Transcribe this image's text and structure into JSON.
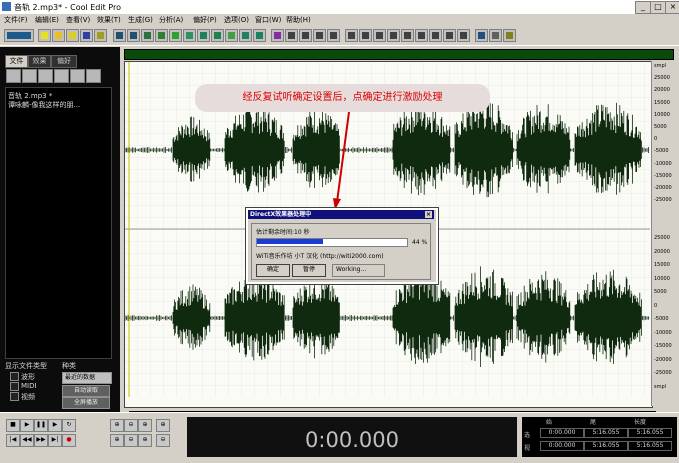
{
  "window": {
    "title": "音轨  2.mp3* - Cool Edit Pro",
    "min_label": "_",
    "max_label": "□",
    "close_label": "×"
  },
  "menu": [
    "文件(F)",
    "编辑(E)",
    "查看(V)",
    "效果(T)",
    "生成(G)",
    "分析(A)",
    "偏好(P)",
    "选项(O)",
    "窗口(W)",
    "帮助(H)"
  ],
  "left_panel": {
    "tabs": [
      "文件",
      "效果",
      "偏好"
    ],
    "files": [
      "音轨   2.mp3 *",
      "谭咏麟-像我这样的朋..."
    ],
    "show_file_type_label": "显示文件类型",
    "sort_label": "种类",
    "types": [
      "波形",
      "MIDI",
      "视频"
    ],
    "sort_value": "最近的数据",
    "sort_button": "自动读取",
    "fullscreen_button": "全屏播放"
  },
  "annotation": "经反复试听确定设置后，点确定进行激励处理",
  "dialog": {
    "title": "DirectX效果器处理中",
    "close_label": "×",
    "time_remaining": "估计剩余时间:10 秒",
    "progress_percent": 44,
    "progress_label": "44 %",
    "credit": "WiTi音乐作坊 小T 汉化 (http://witi2000.com)",
    "ok_button": "确定",
    "pause_button": "暂停",
    "status": "Working..."
  },
  "ruler": {
    "top": [
      "smpl",
      "25000",
      "20000",
      "15000",
      "10000",
      "5000",
      "0",
      "-5000",
      "-10000",
      "-15000",
      "-20000",
      "-25000"
    ],
    "bottom": [
      "25000",
      "20000",
      "15000",
      "10000",
      "5000",
      "0",
      "-5000",
      "-10000",
      "-15000",
      "-20000",
      "-25000",
      "smpl"
    ]
  },
  "timeline": [
    "hms",
    "0:20",
    "0:40",
    "1:00",
    "1:20",
    "1:40",
    "2:00",
    "2:20",
    "2:40",
    "3:00",
    "3:20",
    "3:40",
    "4:00",
    "4:20",
    "4:40",
    "5:00",
    "hms"
  ],
  "transport": {
    "time": "0:00.000"
  },
  "selection": {
    "headers": [
      "始",
      "尾",
      "长度"
    ],
    "row_label": "选",
    "values": [
      "0:00.000",
      "5:16.055",
      "5:16.055"
    ],
    "view_row_label": "视",
    "view_values": [
      "0:00.000",
      "5:16.055",
      "5:16.055"
    ]
  }
}
